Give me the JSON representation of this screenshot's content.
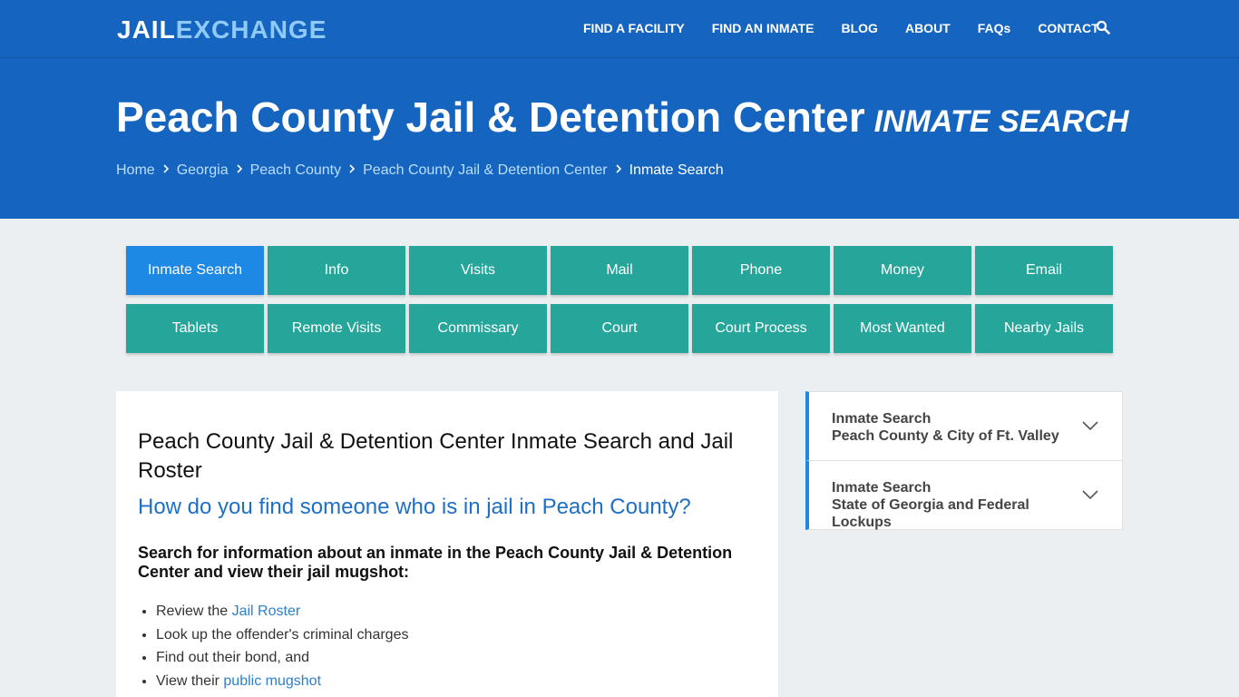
{
  "logo": {
    "part1": "JAIL",
    "part2": "EXCHANGE"
  },
  "nav": {
    "items": [
      "FIND A FACILITY",
      "FIND AN INMATE",
      "BLOG",
      "ABOUT",
      "FAQs",
      "CONTACT"
    ],
    "search_icon": "search-icon"
  },
  "hero": {
    "title": "Peach County Jail & Detention Center",
    "subtitle": "INMATE SEARCH",
    "breadcrumbs": [
      "Home",
      "Georgia",
      "Peach County",
      "Peach County Jail & Detention Center"
    ],
    "breadcrumb_current": "Inmate Search"
  },
  "tabs": {
    "row1": [
      "Inmate Search",
      "Info",
      "Visits",
      "Mail",
      "Phone",
      "Money",
      "Email"
    ],
    "row2": [
      "Tablets",
      "Remote Visits",
      "Commissary",
      "Court",
      "Court Process",
      "Most Wanted",
      "Nearby Jails"
    ],
    "active": "Inmate Search"
  },
  "main": {
    "heading": "Peach County Jail & Detention Center Inmate Search and Jail Roster",
    "question": "How do you find someone who is in jail in Peach County?",
    "lead": "Search for information about an inmate in the Peach County Jail & Detention Center and view their jail mugshot:",
    "list": {
      "item1_prefix": "Review the ",
      "item1_link": "Jail Roster",
      "item2": "Look up the offender's criminal charges",
      "item3": "Find out their bond, and",
      "item4_prefix": "View their ",
      "item4_link": "public mugshot"
    }
  },
  "sidebar": {
    "panel1": {
      "line1": "Inmate Search",
      "line2": "Peach County & City of Ft. Valley"
    },
    "panel2": {
      "line1": "Inmate Search",
      "line2": "State of Georgia and Federal Lockups"
    }
  },
  "colors": {
    "primary": "#1565c0",
    "accent_teal": "#26a69a",
    "active_tab": "#1e88e5",
    "link": "#2c80d0"
  }
}
